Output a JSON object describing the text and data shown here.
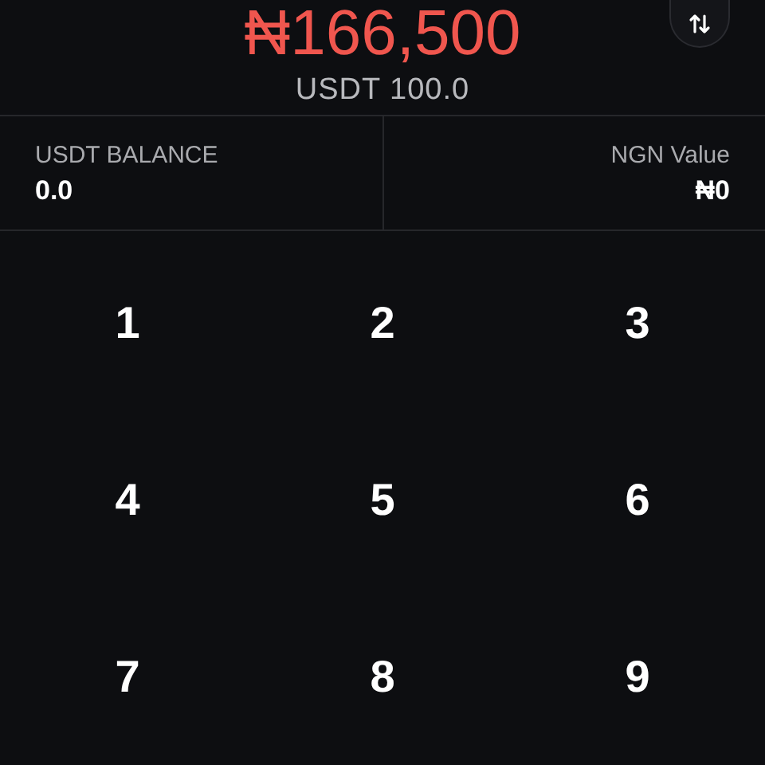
{
  "amount": "₦166,500",
  "converted": "USDT 100.0",
  "balances": [
    {
      "label": "USDT BALANCE",
      "value": "0.0"
    },
    {
      "label": "NGN Value",
      "value": "₦0"
    }
  ],
  "keys": [
    "1",
    "2",
    "3",
    "4",
    "5",
    "6",
    "7",
    "8",
    "9"
  ]
}
